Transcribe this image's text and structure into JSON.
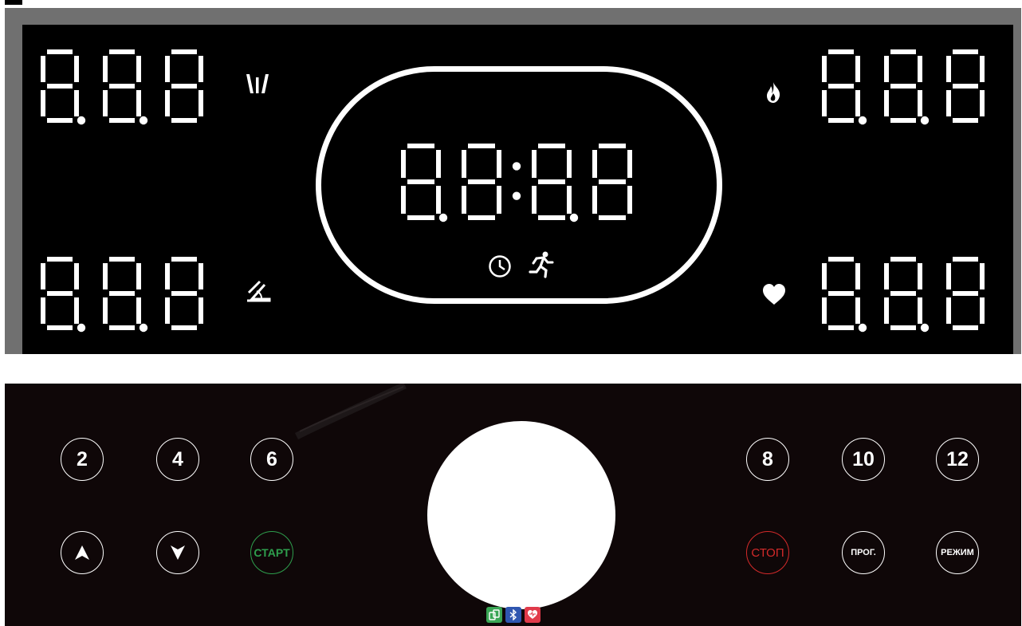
{
  "display": {
    "digits_top_left": "8.8.8",
    "digits_top_right": "8.8.8",
    "digits_bottom_left": "8.8.8",
    "digits_bottom_right": "8.8.8",
    "digits_center": "8.8:8.8",
    "icons": [
      "speed-icon",
      "incline-icon",
      "calories-icon",
      "heart-rate-icon",
      "clock-icon",
      "running-man-icon"
    ],
    "segment_color": "#ffffff",
    "background_color": "#000000"
  },
  "keypad": {
    "speed_keys": [
      "2",
      "4",
      "6",
      "8",
      "10",
      "12"
    ],
    "up_label": "▲",
    "down_label": "▼",
    "start_label": "СТАРТ",
    "stop_label": "СТОП",
    "program_label": "ПРОГ.",
    "mode_label": "РЕЖИМ",
    "start_color": "#2e9e4d",
    "stop_color": "#d42a2a",
    "badges": [
      "app-icon",
      "bluetooth-icon",
      "heart-app-icon"
    ]
  }
}
